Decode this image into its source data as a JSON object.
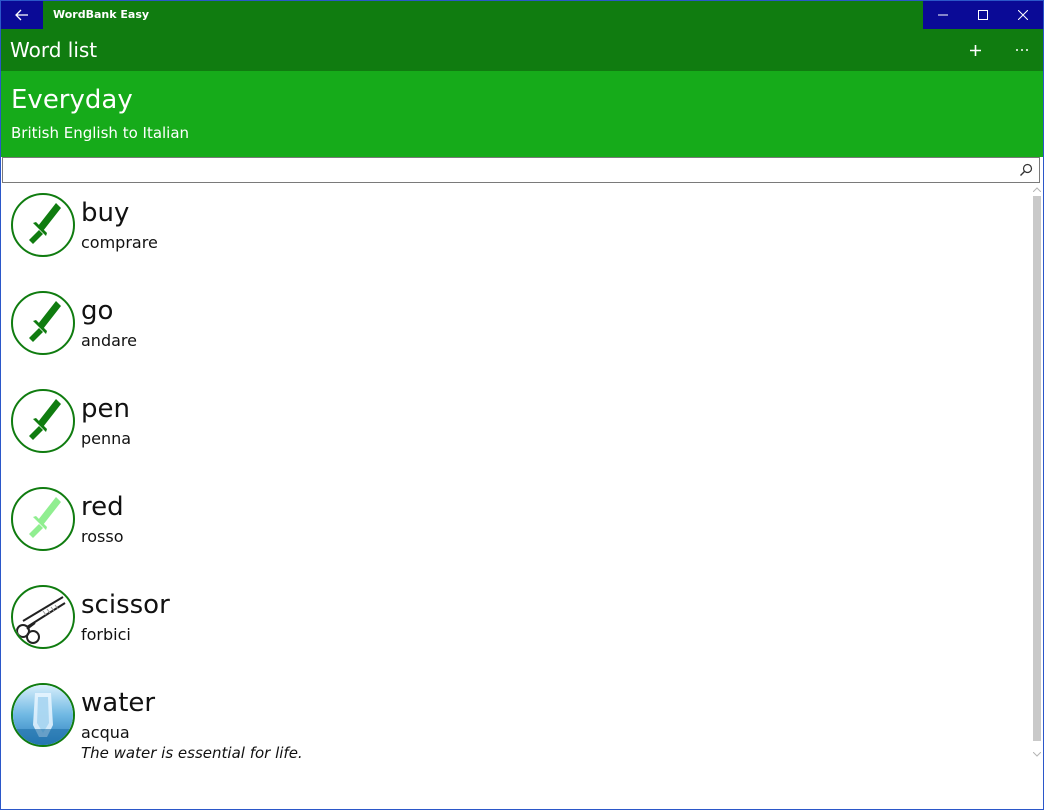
{
  "window": {
    "title": "WordBank Easy",
    "accent": "#107c10",
    "titlebar_controls": [
      "back-arrow-icon",
      "minimize-icon",
      "maximize-icon",
      "close-icon"
    ]
  },
  "command_bar": {
    "title": "Word list",
    "add_label": "+",
    "more_label": "···"
  },
  "header": {
    "title": "Everyday",
    "subtitle": "British English to Italian",
    "background": "#16ab1a"
  },
  "search": {
    "value": "",
    "placeholder": ""
  },
  "items": [
    {
      "word": "buy",
      "translation": "comprare",
      "example": "",
      "icon": "sword-icon",
      "icon_color": "#107c10"
    },
    {
      "word": "go",
      "translation": "andare",
      "example": "",
      "icon": "sword-icon",
      "icon_color": "#107c10"
    },
    {
      "word": "pen",
      "translation": "penna",
      "example": "",
      "icon": "sword-icon",
      "icon_color": "#107c10"
    },
    {
      "word": "red",
      "translation": "rosso",
      "example": "",
      "icon": "sword-icon",
      "icon_color": "#90ee90"
    },
    {
      "word": "scissor",
      "translation": "forbici",
      "example": "",
      "icon": "scissors-image",
      "icon_color": "#222222"
    },
    {
      "word": "water",
      "translation": "acqua",
      "example": "The water is essential for life.",
      "icon": "water-image",
      "icon_color": "#4aa3d8"
    }
  ]
}
